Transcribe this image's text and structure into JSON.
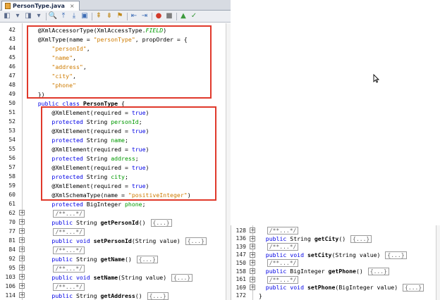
{
  "tab": {
    "title": "PersonType.java",
    "close": "×"
  },
  "toolbar": {
    "buttons": [
      {
        "name": "back",
        "glyph": "◧"
      },
      {
        "name": "back-dropdown",
        "glyph": "▾"
      },
      {
        "name": "forward",
        "glyph": "◨"
      },
      {
        "name": "forward-dropdown",
        "glyph": "▾"
      },
      {
        "name": "find",
        "glyph": "🔍"
      },
      {
        "name": "find-prev",
        "glyph": "⤒"
      },
      {
        "name": "find-next",
        "glyph": "⤓"
      },
      {
        "name": "toggle-highlight",
        "glyph": "▣"
      },
      {
        "name": "prev-bookmark",
        "glyph": "⇞"
      },
      {
        "name": "next-bookmark",
        "glyph": "⇟"
      },
      {
        "name": "toggle-bookmark",
        "glyph": "⚑"
      },
      {
        "name": "shift-left",
        "glyph": "⇤"
      },
      {
        "name": "shift-right",
        "glyph": "⇥"
      },
      {
        "name": "start-macro",
        "glyph": "●"
      },
      {
        "name": "stop-macro",
        "glyph": "■"
      },
      {
        "name": "run",
        "glyph": "▲"
      },
      {
        "name": "check",
        "glyph": "✓"
      }
    ]
  },
  "left_lines": [
    {
      "n": "42",
      "fold": "",
      "parts": [
        [
          "",
          "    @XmlAccessorType(XmlAccessType."
        ],
        [
          "it",
          "FIELD"
        ],
        [
          "",
          ")"
        ]
      ]
    },
    {
      "n": "43",
      "fold": "",
      "parts": [
        [
          "",
          "    @XmlType(name = "
        ],
        [
          "str",
          "\"personType\""
        ],
        [
          "",
          ", propOrder = {"
        ]
      ]
    },
    {
      "n": "44",
      "fold": "",
      "parts": [
        [
          "str",
          "        \"personId\""
        ],
        [
          "",
          ","
        ]
      ]
    },
    {
      "n": "45",
      "fold": "",
      "parts": [
        [
          "str",
          "        \"name\""
        ],
        [
          "",
          ","
        ]
      ]
    },
    {
      "n": "46",
      "fold": "",
      "parts": [
        [
          "str",
          "        \"address\""
        ],
        [
          "",
          ","
        ]
      ]
    },
    {
      "n": "47",
      "fold": "",
      "parts": [
        [
          "str",
          "        \"city\""
        ],
        [
          "",
          ","
        ]
      ]
    },
    {
      "n": "48",
      "fold": "",
      "parts": [
        [
          "str",
          "        \"phone\""
        ]
      ]
    },
    {
      "n": "49",
      "fold": "",
      "parts": [
        [
          "",
          "    })"
        ]
      ]
    },
    {
      "n": "50",
      "fold": "",
      "parts": [
        [
          "kw",
          "    public class "
        ],
        [
          "bold",
          "PersonType"
        ],
        [
          "",
          " {"
        ]
      ]
    },
    {
      "n": "51",
      "fold": "",
      "parts": [
        [
          "",
          "        @XmlElement(required = "
        ],
        [
          "kw",
          "true"
        ],
        [
          "",
          ")"
        ]
      ]
    },
    {
      "n": "52",
      "fold": "",
      "parts": [
        [
          "kw",
          "        protected "
        ],
        [
          "",
          "String "
        ],
        [
          "fld",
          "personId"
        ],
        [
          "",
          ";"
        ]
      ]
    },
    {
      "n": "53",
      "fold": "",
      "parts": [
        [
          "",
          "        @XmlElement(required = "
        ],
        [
          "kw",
          "true"
        ],
        [
          "",
          ")"
        ]
      ]
    },
    {
      "n": "54",
      "fold": "",
      "parts": [
        [
          "kw",
          "        protected "
        ],
        [
          "",
          "String "
        ],
        [
          "fld",
          "name"
        ],
        [
          "",
          ";"
        ]
      ]
    },
    {
      "n": "55",
      "fold": "",
      "parts": [
        [
          "",
          "        @XmlElement(required = "
        ],
        [
          "kw",
          "true"
        ],
        [
          "",
          ")"
        ]
      ]
    },
    {
      "n": "56",
      "fold": "",
      "parts": [
        [
          "kw",
          "        protected "
        ],
        [
          "",
          "String "
        ],
        [
          "fld",
          "address"
        ],
        [
          "",
          ";"
        ]
      ]
    },
    {
      "n": "57",
      "fold": "",
      "parts": [
        [
          "",
          "        @XmlElement(required = "
        ],
        [
          "kw",
          "true"
        ],
        [
          "",
          ")"
        ]
      ]
    },
    {
      "n": "58",
      "fold": "",
      "parts": [
        [
          "kw",
          "        protected "
        ],
        [
          "",
          "String "
        ],
        [
          "fld",
          "city"
        ],
        [
          "",
          ";"
        ]
      ]
    },
    {
      "n": "59",
      "fold": "",
      "parts": [
        [
          "",
          "        @XmlElement(required = "
        ],
        [
          "kw",
          "true"
        ],
        [
          "",
          ")"
        ]
      ]
    },
    {
      "n": "60",
      "fold": "",
      "parts": [
        [
          "",
          "        @XmlSchemaType(name = "
        ],
        [
          "str",
          "\"positiveInteger\""
        ],
        [
          "",
          ")"
        ]
      ]
    },
    {
      "n": "61",
      "fold": "",
      "parts": [
        [
          "kw",
          "        protected "
        ],
        [
          "",
          "BigInteger "
        ],
        [
          "fld",
          "phone"
        ],
        [
          "",
          ";"
        ]
      ]
    },
    {
      "n": "62",
      "fold": "+",
      "parts": [
        [
          "collapsed",
          "/**...*/"
        ]
      ],
      "indent": "        "
    },
    {
      "n": "70",
      "fold": "+",
      "parts": [
        [
          "kw",
          "        public "
        ],
        [
          "",
          "String "
        ],
        [
          "bold",
          "getPersonId"
        ],
        [
          "",
          "() "
        ],
        [
          "collapsed",
          "{...}"
        ]
      ]
    },
    {
      "n": "77",
      "fold": "+",
      "parts": [
        [
          "collapsed",
          "/**...*/"
        ]
      ],
      "indent": "        "
    },
    {
      "n": "81",
      "fold": "+",
      "parts": [
        [
          "kw",
          "        public void "
        ],
        [
          "bold",
          "setPersonId"
        ],
        [
          "",
          "(String value) "
        ],
        [
          "collapsed",
          "{...}"
        ]
      ]
    },
    {
      "n": "84",
      "fold": "+",
      "parts": [
        [
          "collapsed",
          "/**...*/"
        ]
      ],
      "indent": "        "
    },
    {
      "n": "92",
      "fold": "+",
      "parts": [
        [
          "kw",
          "        public "
        ],
        [
          "",
          "String "
        ],
        [
          "bold",
          "getName"
        ],
        [
          "",
          "() "
        ],
        [
          "collapsed",
          "{...}"
        ]
      ]
    },
    {
      "n": "95",
      "fold": "+",
      "parts": [
        [
          "collapsed",
          "/**...*/"
        ]
      ],
      "indent": "        "
    },
    {
      "n": "103",
      "fold": "+",
      "parts": [
        [
          "kw",
          "        public void "
        ],
        [
          "bold",
          "setName"
        ],
        [
          "",
          "(String value) "
        ],
        [
          "collapsed",
          "{...}"
        ]
      ]
    },
    {
      "n": "106",
      "fold": "+",
      "parts": [
        [
          "collapsed",
          "/**...*/"
        ]
      ],
      "indent": "        "
    },
    {
      "n": "114",
      "fold": "+",
      "parts": [
        [
          "kw",
          "        public "
        ],
        [
          "",
          "String "
        ],
        [
          "bold",
          "getAddress"
        ],
        [
          "",
          "() "
        ],
        [
          "collapsed",
          "{...}"
        ]
      ]
    }
  ],
  "right_lines": [
    {
      "n": "128",
      "fold": "+",
      "parts": [
        [
          "collapsed",
          "/**...*/"
        ]
      ],
      "indent": "   "
    },
    {
      "n": "136",
      "fold": "+",
      "parts": [
        [
          "kw",
          "   public "
        ],
        [
          "",
          "String "
        ],
        [
          "bold",
          "getCity"
        ],
        [
          "",
          "() "
        ],
        [
          "collapsed",
          "{...}"
        ]
      ]
    },
    {
      "n": "139",
      "fold": "+",
      "parts": [
        [
          "collapsed",
          "/**...*/"
        ]
      ],
      "indent": "   "
    },
    {
      "n": "147",
      "fold": "+",
      "parts": [
        [
          "kw",
          "   public void "
        ],
        [
          "bold",
          "setCity"
        ],
        [
          "",
          "(String value) "
        ],
        [
          "collapsed",
          "{...}"
        ]
      ]
    },
    {
      "n": "150",
      "fold": "+",
      "parts": [
        [
          "collapsed",
          "/**...*/"
        ]
      ],
      "indent": "   "
    },
    {
      "n": "158",
      "fold": "+",
      "parts": [
        [
          "kw",
          "   public "
        ],
        [
          "",
          "BigInteger "
        ],
        [
          "bold",
          "getPhone"
        ],
        [
          "",
          "() "
        ],
        [
          "collapsed",
          "{...}"
        ]
      ]
    },
    {
      "n": "161",
      "fold": "+",
      "parts": [
        [
          "collapsed",
          "/**...*/"
        ]
      ],
      "indent": "   "
    },
    {
      "n": "169",
      "fold": "+",
      "parts": [
        [
          "kw",
          "   public void "
        ],
        [
          "bold",
          "setPhone"
        ],
        [
          "",
          "(BigInteger value) "
        ],
        [
          "collapsed",
          "{...}"
        ]
      ]
    },
    {
      "n": "172",
      "fold": "",
      "parts": [
        [
          "",
          " }"
        ]
      ]
    }
  ],
  "colors": {
    "highlight_border": "#e0392b",
    "keyword": "#0000e6",
    "string": "#ce7b00",
    "field": "#009900"
  }
}
